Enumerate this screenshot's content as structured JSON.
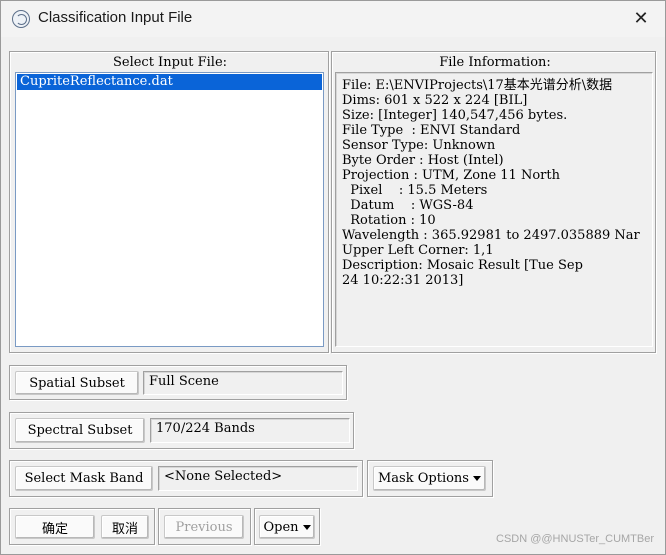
{
  "window": {
    "title": "Classification Input File",
    "icon": "envi-app-icon",
    "close_glyph": "✕"
  },
  "select_panel": {
    "title": "Select Input File:",
    "files": [
      {
        "name": "CupriteReflectance.dat",
        "selected": true
      }
    ]
  },
  "info_panel": {
    "title": "File Information:",
    "lines": [
      "File: E:\\ENVIProjects\\17基本光谱分析\\数据",
      "Dims: 601 x 522 x 224 [BIL]",
      "Size: [Integer] 140,547,456 bytes.",
      "File Type  : ENVI Standard",
      "Sensor Type: Unknown",
      "Byte Order : Host (Intel)",
      "Projection : UTM, Zone 11 North",
      "  Pixel    : 15.5 Meters",
      "  Datum    : WGS-84",
      "  Rotation : 10",
      "Wavelength : 365.92981 to 2497.035889 Nar",
      "Upper Left Corner: 1,1",
      "Description: Mosaic Result [Tue Sep",
      "24 10:22:31 2013]"
    ]
  },
  "spatial_subset": {
    "button": "Spatial Subset",
    "value": "Full Scene"
  },
  "spectral_subset": {
    "button": "Spectral Subset",
    "value": "170/224 Bands"
  },
  "mask_band": {
    "button": "Select Mask Band",
    "value": "<None Selected>"
  },
  "mask_options": {
    "label": "Mask Options"
  },
  "footer": {
    "ok": "确定",
    "cancel": "取消",
    "previous": "Previous",
    "open": "Open"
  },
  "watermark": "CSDN @@HNUSTer_CUMTBer"
}
